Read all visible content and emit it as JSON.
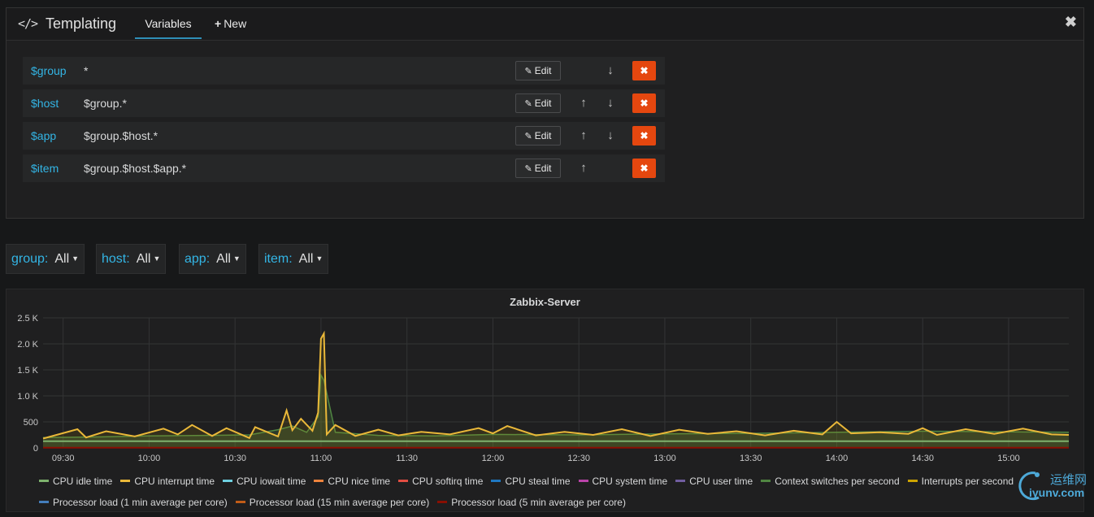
{
  "header": {
    "title_icon": "</>",
    "title": "Templating",
    "tabs": [
      {
        "label": "Variables",
        "active": true
      },
      {
        "label": "New",
        "icon": "plus-icon"
      }
    ],
    "close_icon": "close-icon"
  },
  "variables": [
    {
      "name": "$group",
      "query": "*",
      "edit_label": "Edit",
      "can_move_up": false,
      "can_move_down": true
    },
    {
      "name": "$host",
      "query": "$group.*",
      "edit_label": "Edit",
      "can_move_up": true,
      "can_move_down": true
    },
    {
      "name": "$app",
      "query": "$group.$host.*",
      "edit_label": "Edit",
      "can_move_up": true,
      "can_move_down": true
    },
    {
      "name": "$item",
      "query": "$group.$host.$app.*",
      "edit_label": "Edit",
      "can_move_up": true,
      "can_move_down": false
    }
  ],
  "selectors": [
    {
      "label": "group:",
      "value": "All"
    },
    {
      "label": "host:",
      "value": "All"
    },
    {
      "label": "app:",
      "value": "All"
    },
    {
      "label": "item:",
      "value": "All"
    }
  ],
  "colors": {
    "accent": "#33b5e5",
    "delete": "#e5470f",
    "tab_underline": "#2f8fb8"
  },
  "chart_data": {
    "type": "line",
    "title": "Zabbix-Server",
    "y_ticks": [
      "0",
      "500",
      "1.0 K",
      "1.5 K",
      "2.0 K",
      "2.5 K"
    ],
    "ylim": [
      0,
      2500
    ],
    "x_ticks": [
      "09:30",
      "10:00",
      "10:30",
      "11:00",
      "11:30",
      "12:00",
      "12:30",
      "13:00",
      "13:30",
      "14:00",
      "14:30",
      "15:00"
    ],
    "xlim": [
      "09:23",
      "15:21"
    ],
    "grid": true,
    "legend_position": "bottom",
    "series": [
      {
        "name": "CPU idle time",
        "color": "#7eb26d"
      },
      {
        "name": "CPU interrupt time",
        "color": "#eab839"
      },
      {
        "name": "CPU iowait time",
        "color": "#6ed0e0"
      },
      {
        "name": "CPU nice time",
        "color": "#ef843c"
      },
      {
        "name": "CPU softirq time",
        "color": "#e24d42"
      },
      {
        "name": "CPU steal time",
        "color": "#1f78c1"
      },
      {
        "name": "CPU system time",
        "color": "#ba43a9"
      },
      {
        "name": "CPU user time",
        "color": "#705da0"
      },
      {
        "name": "Context switches per second",
        "color": "#508642"
      },
      {
        "name": "Interrupts per second",
        "color": "#cca300"
      },
      {
        "name": "Processor load (1 min average per core)",
        "color": "#447ebc"
      },
      {
        "name": "Processor load (15 min average per core)",
        "color": "#c15c17"
      },
      {
        "name": "Processor load (5 min average per core)",
        "color": "#890f02"
      }
    ],
    "interrupts_per_second": {
      "x": [
        "09:23",
        "09:35",
        "09:38",
        "09:45",
        "09:55",
        "10:05",
        "10:10",
        "10:15",
        "10:22",
        "10:27",
        "10:35",
        "10:37",
        "10:45",
        "10:48",
        "10:50",
        "10:53",
        "10:57",
        "10:59",
        "11:00",
        "11:01",
        "11:02",
        "11:05",
        "11:12",
        "11:20",
        "11:27",
        "11:35",
        "11:45",
        "11:55",
        "12:00",
        "12:05",
        "12:15",
        "12:25",
        "12:35",
        "12:45",
        "12:55",
        "13:05",
        "13:15",
        "13:25",
        "13:35",
        "13:45",
        "13:55",
        "14:00",
        "14:05",
        "14:15",
        "14:25",
        "14:30",
        "14:35",
        "14:45",
        "14:55",
        "15:05",
        "15:15",
        "15:21"
      ],
      "values": [
        180,
        360,
        200,
        320,
        220,
        370,
        260,
        440,
        230,
        380,
        190,
        400,
        220,
        720,
        340,
        560,
        330,
        680,
        2100,
        2200,
        260,
        440,
        230,
        350,
        240,
        310,
        260,
        380,
        280,
        420,
        240,
        310,
        250,
        360,
        230,
        350,
        270,
        320,
        240,
        330,
        260,
        500,
        280,
        300,
        270,
        380,
        250,
        360,
        270,
        370,
        260,
        250
      ]
    },
    "context_switches_per_second": {
      "x": [
        "09:23",
        "09:40",
        "10:00",
        "10:20",
        "10:35",
        "10:45",
        "10:50",
        "10:55",
        "10:59",
        "11:00",
        "11:01",
        "11:05",
        "11:20",
        "11:40",
        "12:00",
        "12:30",
        "13:00",
        "13:30",
        "14:00",
        "14:30",
        "15:00",
        "15:21"
      ],
      "values": [
        200,
        210,
        230,
        240,
        250,
        350,
        420,
        300,
        600,
        1400,
        1300,
        300,
        240,
        230,
        260,
        250,
        270,
        280,
        300,
        320,
        310,
        300
      ]
    },
    "cpu_idle_time": {
      "x": [
        "09:23",
        "15:21"
      ],
      "values": [
        130,
        130
      ]
    },
    "processor_load_5min": {
      "x": [
        "09:23",
        "15:21"
      ],
      "values": [
        5,
        5
      ]
    }
  }
}
